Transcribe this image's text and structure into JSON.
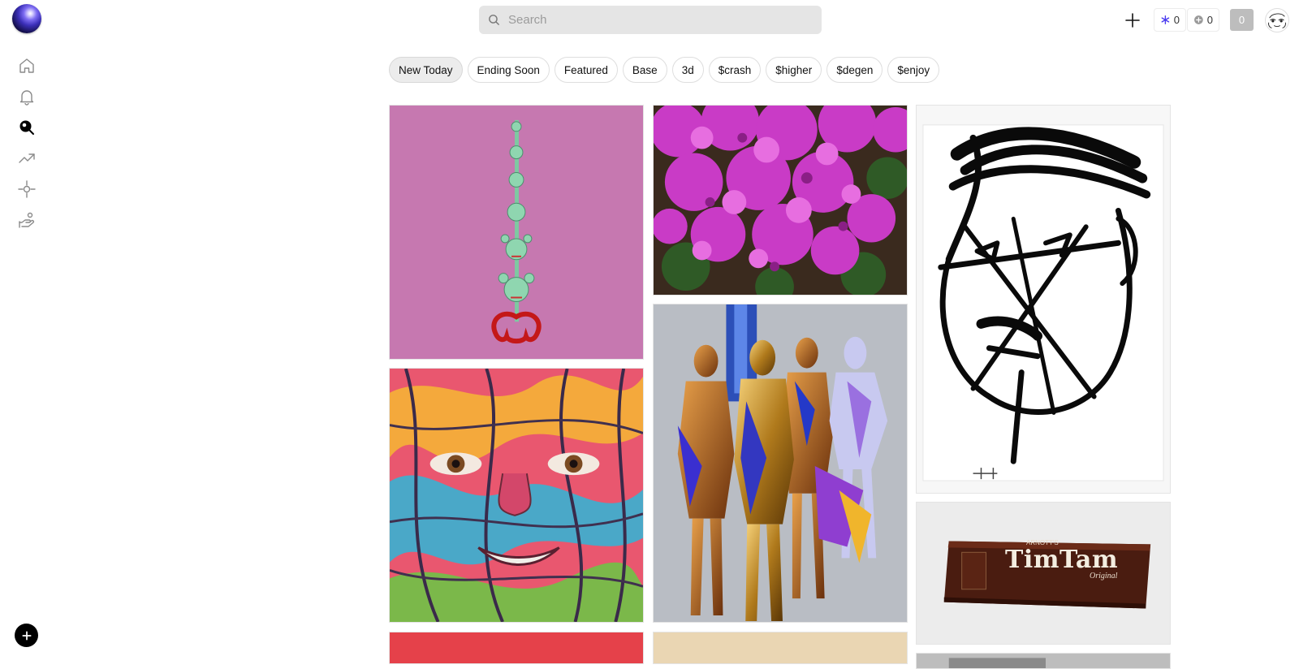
{
  "search": {
    "placeholder": "Search"
  },
  "header": {
    "notification_count": "0",
    "plus_count": "0",
    "balance": "0"
  },
  "filters": [
    "New Today",
    "Ending Soon",
    "Featured",
    "Base",
    "3d",
    "$crash",
    "$higher",
    "$degen",
    "$enjoy"
  ],
  "active_filter": "New Today",
  "tiles": [
    {
      "name": "tile-pink-sculpture",
      "text": ""
    },
    {
      "name": "tile-bougainvillea",
      "text": ""
    },
    {
      "name": "tile-ink-face",
      "text": ""
    },
    {
      "name": "tile-painted-face",
      "text": ""
    },
    {
      "name": "tile-gold-figures",
      "text": ""
    },
    {
      "name": "tile-timtam",
      "text": "TimTam"
    },
    {
      "name": "tile-red-partial",
      "text": ""
    },
    {
      "name": "tile-beige-partial",
      "text": ""
    },
    {
      "name": "tile-grey-partial",
      "text": ""
    }
  ],
  "timtam": {
    "brand": "TimTam",
    "maker": "ARNOTT'S",
    "variant": "Original"
  },
  "colors": {
    "accent_blue": "#4b3cf0",
    "chip_active": "#ececec",
    "search_bg": "#e5e5e5"
  }
}
